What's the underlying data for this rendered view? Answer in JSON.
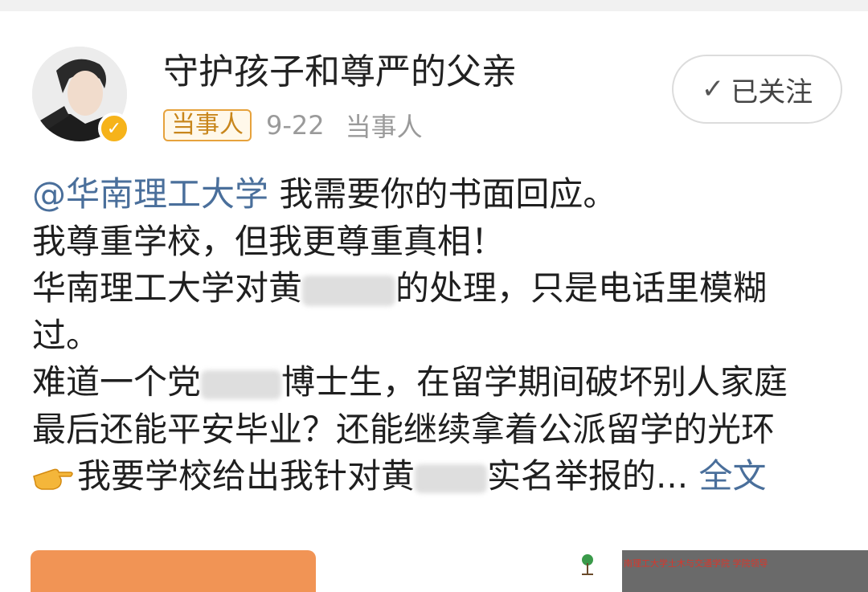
{
  "post": {
    "author_name": "守护孩子和尊严的父亲",
    "tag_label": "当事人",
    "date": "9-22",
    "source": "当事人",
    "follow_label": "已关注",
    "colors": {
      "mention": "#4a6f9b",
      "tag_border": "#e6a23c",
      "verified": "#f6b31a"
    }
  },
  "content": {
    "line1_mention": "@华南理工大学",
    "line1_text": " 我需要你的书面回应。",
    "line2": "我尊重学校，但我更尊重真相！",
    "line3_a": "华南理工大学对黄",
    "line3_b": "的处理，只是电话里模糊",
    "line4": "过。",
    "line5_a": "难道一个党",
    "line5_b": "博士生，在留学期间破坏别人家庭",
    "line6": "最后还能平安毕业？还能继续拿着公派留学的光环",
    "line7_a": "我要学校给出我针对黄",
    "line7_b": "实名举报的...",
    "more_label": "全文"
  },
  "media": {
    "caption": "南理工大学土木与交通学院 学院领导"
  },
  "icons": {
    "avatar": "avatar-photo",
    "verified": "verified-badge-icon",
    "check": "check-icon",
    "pointing_hand": "pointing-hand-icon"
  }
}
